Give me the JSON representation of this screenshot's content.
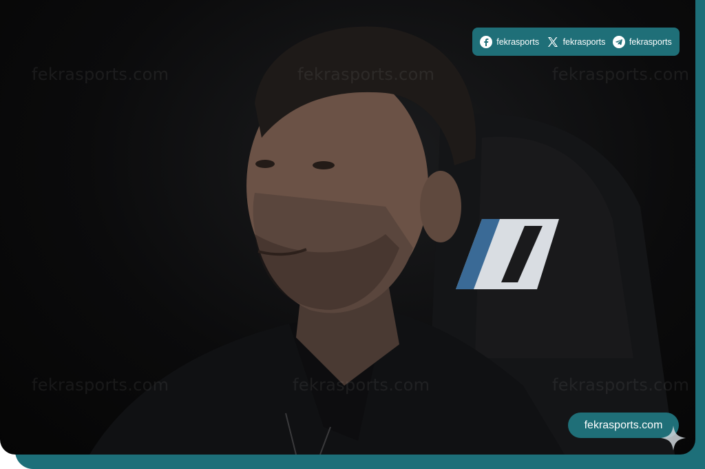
{
  "social_bar": {
    "items": [
      {
        "icon": "facebook-icon",
        "label": "fekrasports"
      },
      {
        "icon": "x-icon",
        "label": "fekrasports"
      },
      {
        "icon": "telegram-icon",
        "label": "fekrasports"
      }
    ]
  },
  "watermark": {
    "text": "fekrasports.com"
  },
  "site_badge": {
    "label": "fekrasports.com"
  },
  "colors": {
    "brand_teal": "#1f6f78",
    "background": "#0b0b0c"
  }
}
